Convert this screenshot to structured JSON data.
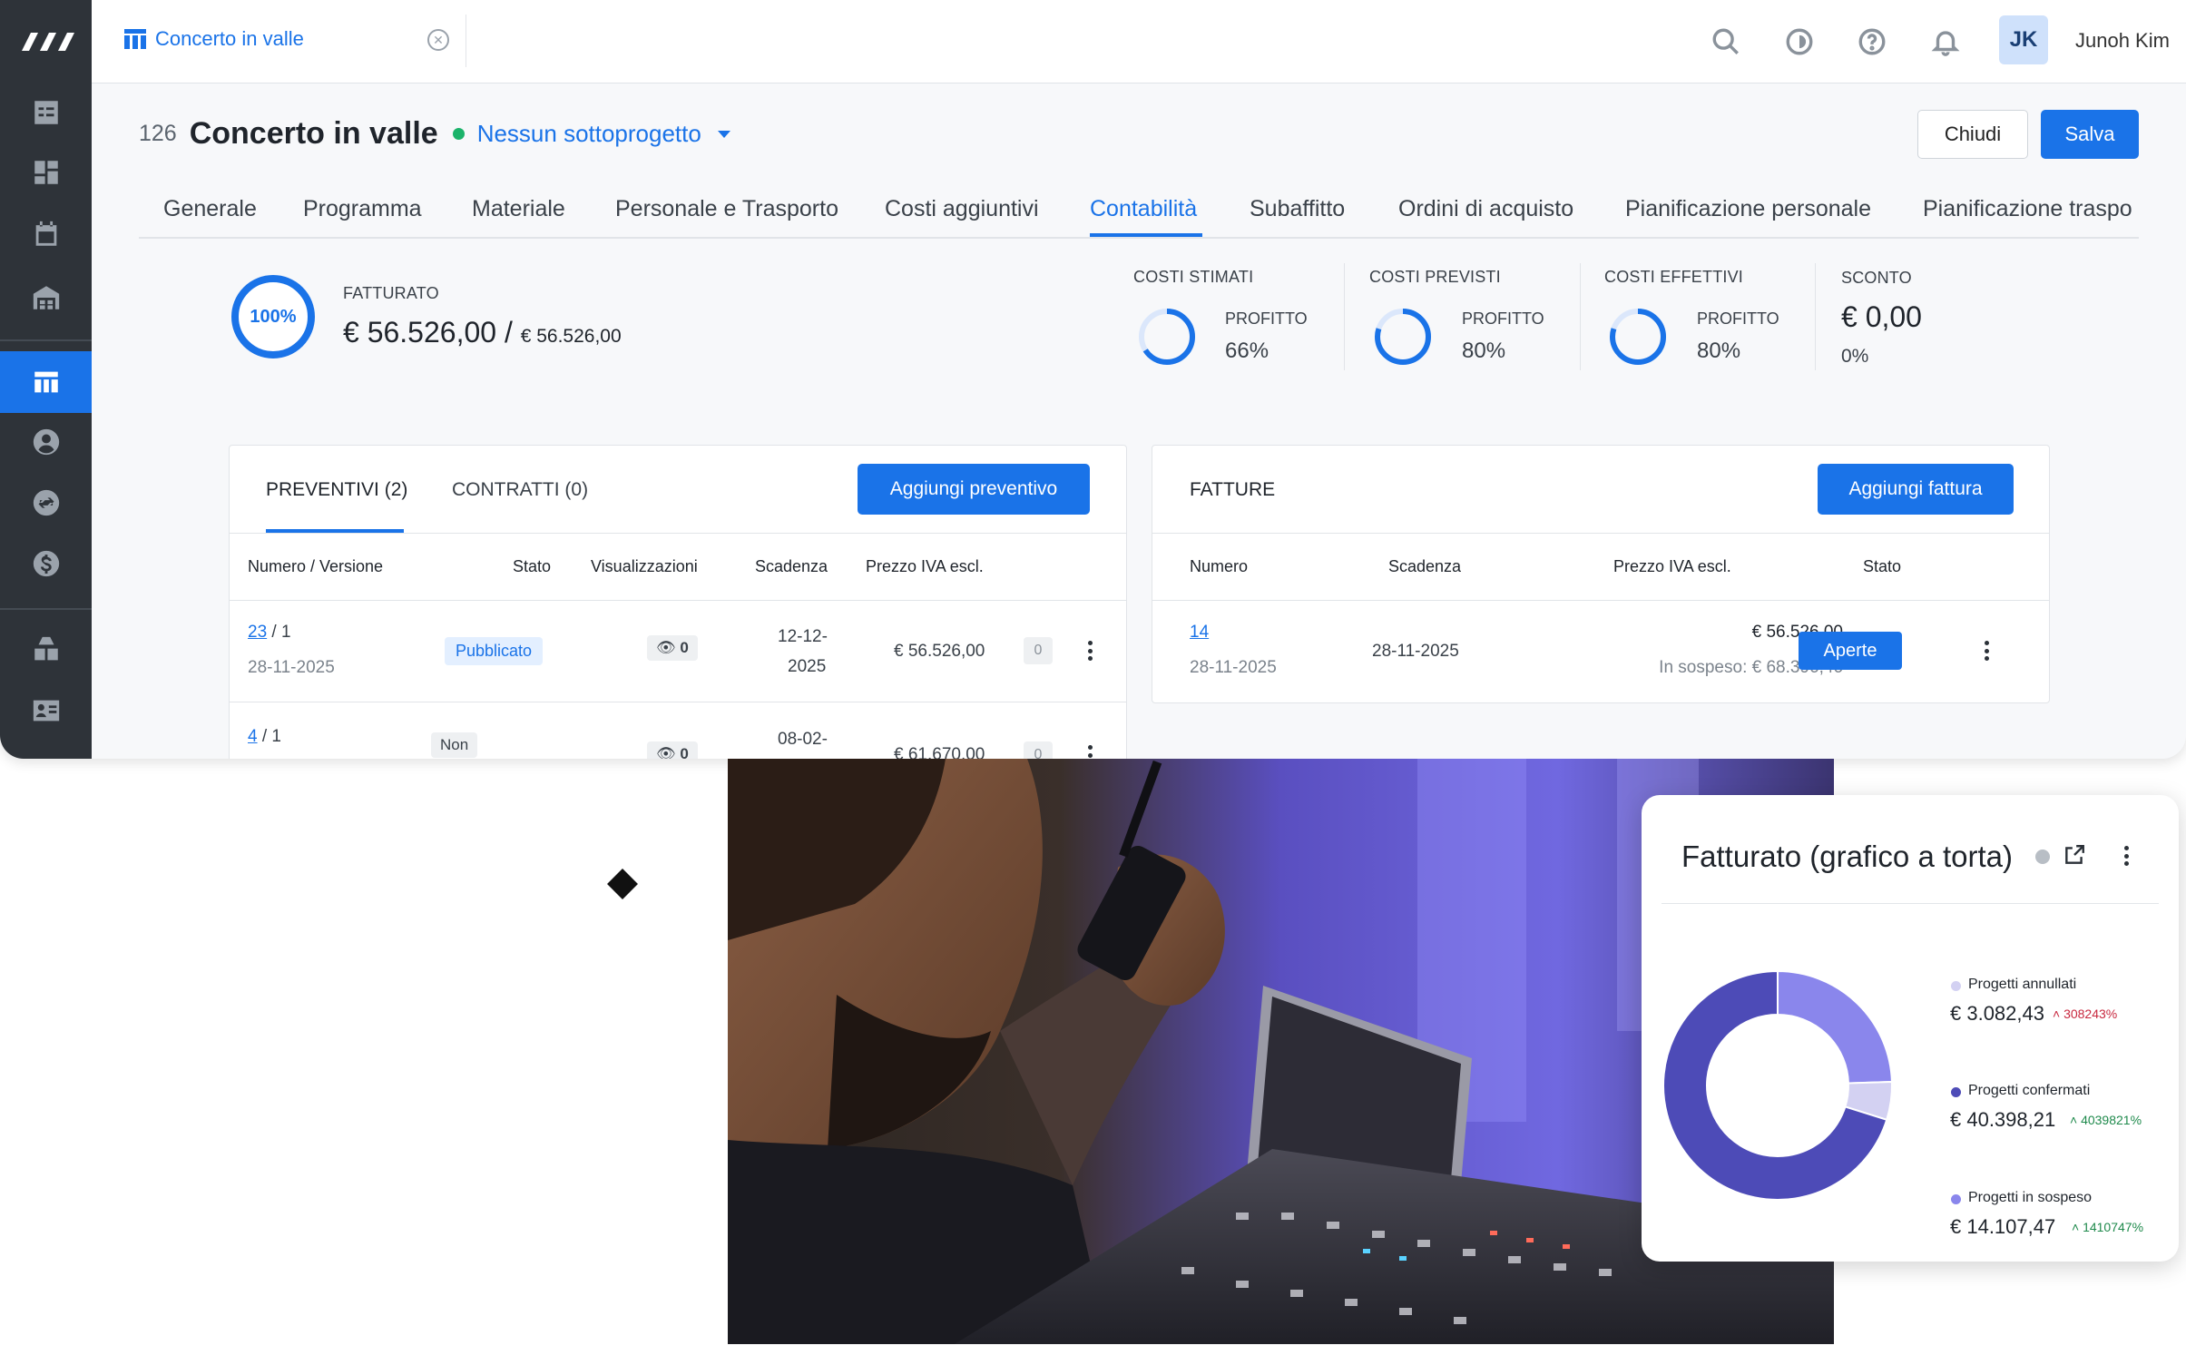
{
  "sidebar": {
    "logo": "logo-icon",
    "items": [
      "task-list-icon",
      "dashboard-icon",
      "calendar-icon",
      "warehouse-icon",
      "projects-table-icon",
      "contacts-icon",
      "sync-icon",
      "finance-icon",
      "inventory-icon",
      "crew-card-icon"
    ],
    "active_index": 4
  },
  "topbar": {
    "tab_label": "Concerto in valle",
    "user_initials": "JK",
    "user_name": "Junoh Kim",
    "icons": [
      "search-icon",
      "theme-icon",
      "help-icon",
      "bell-icon"
    ]
  },
  "project": {
    "number": "126",
    "title": "Concerto in valle",
    "status_color": "#1bb36a",
    "subproject": "Nessun sottoprogetto",
    "close_label": "Chiudi",
    "save_label": "Salva"
  },
  "tabs": {
    "items": [
      "Generale",
      "Programma",
      "Materiale",
      "Personale e Trasporto",
      "Costi aggiuntivi",
      "Contabilità",
      "Subaffitto",
      "Ordini di acquisto",
      "Pianificazione personale",
      "Pianificazione traspo"
    ],
    "active": "Contabilità"
  },
  "summary": {
    "fatturato_pct": "100%",
    "fatturato_label": "FATTURATO",
    "fatturato_value": "€ 56.526,00 /",
    "fatturato_total": "€ 56.526,00",
    "fatturato_fraction": 1.0,
    "cost_blocks": [
      {
        "label": "COSTI STIMATI",
        "profit_label": "PROFITTO",
        "profit": "66%",
        "fraction": 0.66
      },
      {
        "label": "COSTI PREVISTI",
        "profit_label": "PROFITTO",
        "profit": "80%",
        "fraction": 0.8
      },
      {
        "label": "COSTI EFFETTIVI",
        "profit_label": "PROFITTO",
        "profit": "80%",
        "fraction": 0.8
      }
    ],
    "sconto_label": "SCONTO",
    "sconto_value": "€ 0,00",
    "sconto_pct": "0%"
  },
  "quotes": {
    "tab_preventivi": "PREVENTIVI (2)",
    "tab_contratti": "CONTRATTI (0)",
    "add_label": "Aggiungi preventivo",
    "columns": [
      "Numero / Versione",
      "Stato",
      "Visualizzazioni",
      "Scadenza",
      "Prezzo IVA escl."
    ],
    "rows": [
      {
        "num": "23",
        "ver": "/ 1",
        "date": "28-11-2025",
        "status": "Pubblicato",
        "views": "0",
        "due1": "12-12-",
        "due2": "2025",
        "price": "€ 56.526,00",
        "count": "0"
      },
      {
        "num": "4",
        "ver": "/ 1",
        "date": "",
        "status": "Non",
        "views": "0",
        "due1": "08-02-",
        "due2": "",
        "price": "€ 61.670,00",
        "count": "0"
      }
    ]
  },
  "invoices": {
    "title": "FATTURE",
    "add_label": "Aggiungi fattura",
    "columns": [
      "Numero",
      "Scadenza",
      "Prezzo IVA escl.",
      "Stato"
    ],
    "rows": [
      {
        "num": "14",
        "date": "28-11-2025",
        "due": "28-11-2025",
        "price": "€ 56.526,00",
        "pending": "In sospeso: € 68.396,46",
        "status": "Aperte"
      }
    ]
  },
  "card": {
    "title": "Fatturato (grafico a torta)",
    "icons": [
      "info-icon",
      "external-link-icon",
      "kebab-icon"
    ]
  },
  "chart_data": {
    "type": "pie",
    "title": "Fatturato (grafico a torta)",
    "categories": [
      "Progetti annullati",
      "Progetti confermati",
      "Progetti in sospeso"
    ],
    "values": [
      3082.43,
      40398.21,
      14107.47
    ],
    "value_labels": [
      "€ 3.082,43",
      "€ 40.398,21",
      "€ 14.107,47"
    ],
    "changes": [
      "308243%",
      "4039821%",
      "1410747%"
    ],
    "change_colors": [
      "#c8283f",
      "#1f8a4c",
      "#1f8a4c"
    ],
    "colors": [
      "#d3d1f2",
      "#4d4bb7",
      "#8a86ec"
    ],
    "donut": true,
    "legend": "right"
  }
}
